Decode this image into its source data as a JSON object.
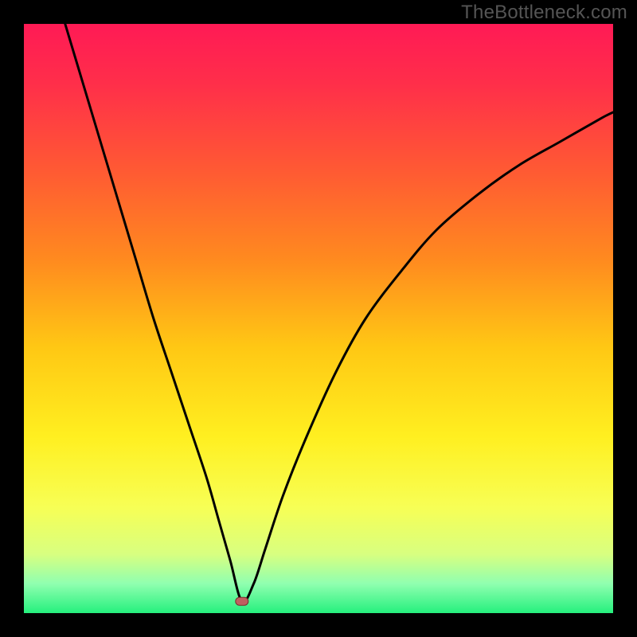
{
  "watermark": "TheBottleneck.com",
  "colors": {
    "frame_bg": "#000000",
    "curve": "#000000",
    "marker_fill": "#c06060",
    "marker_stroke": "#7a2e2e",
    "gradient_stops": [
      {
        "offset": 0.0,
        "color": "#ff1a55"
      },
      {
        "offset": 0.1,
        "color": "#ff2e4a"
      },
      {
        "offset": 0.25,
        "color": "#ff5a33"
      },
      {
        "offset": 0.4,
        "color": "#ff8a1f"
      },
      {
        "offset": 0.55,
        "color": "#ffc814"
      },
      {
        "offset": 0.7,
        "color": "#ffef20"
      },
      {
        "offset": 0.82,
        "color": "#f7ff55"
      },
      {
        "offset": 0.9,
        "color": "#d8ff80"
      },
      {
        "offset": 0.95,
        "color": "#90ffb0"
      },
      {
        "offset": 1.0,
        "color": "#25f07d"
      }
    ]
  },
  "chart_data": {
    "type": "line",
    "title": "",
    "xlabel": "",
    "ylabel": "",
    "xlim": [
      0,
      100
    ],
    "ylim": [
      0,
      100
    ],
    "marker": {
      "x": 37,
      "y": 2
    },
    "series": [
      {
        "name": "bottleneck-curve",
        "x": [
          7,
          10,
          13,
          16,
          19,
          22,
          25,
          28,
          31,
          33,
          35,
          37,
          39,
          41,
          44,
          48,
          53,
          58,
          64,
          70,
          77,
          84,
          91,
          98,
          100
        ],
        "y": [
          100,
          90,
          80,
          70,
          60,
          50,
          41,
          32,
          23,
          16,
          9,
          2,
          5,
          11,
          20,
          30,
          41,
          50,
          58,
          65,
          71,
          76,
          80,
          84,
          85
        ]
      }
    ]
  }
}
